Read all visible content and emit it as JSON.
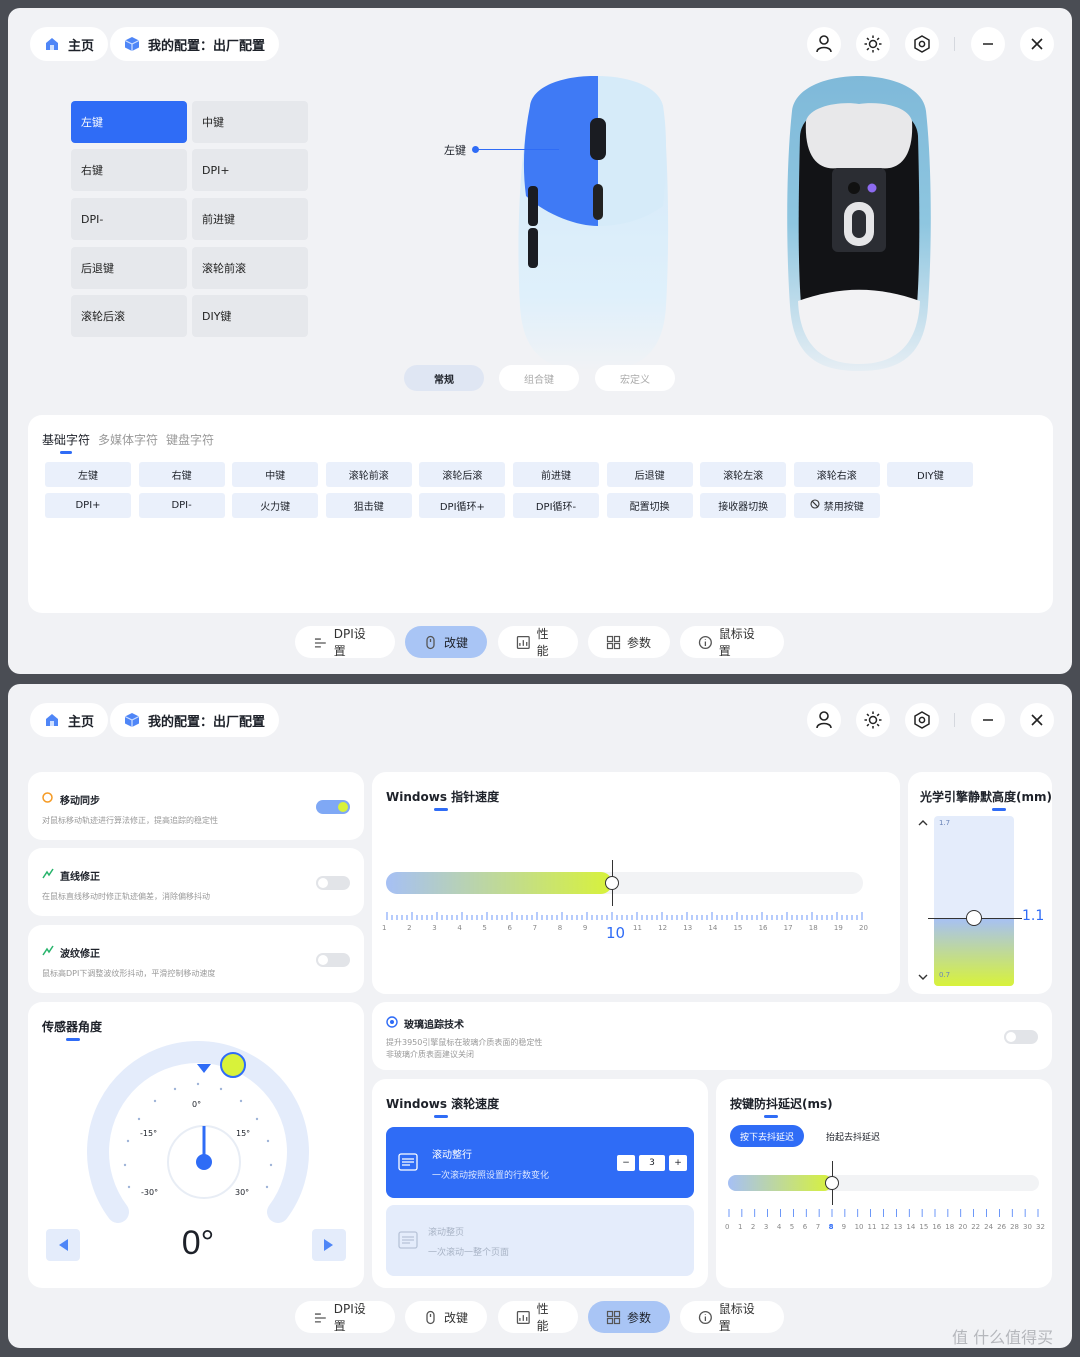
{
  "header": {
    "home": "主页",
    "config": "我的配置：出厂配置"
  },
  "icons": {
    "home": "home-icon",
    "config": "cube-icon",
    "user": "user-icon",
    "light": "light-icon",
    "settings": "hex-gear-icon",
    "minimize": "minimize-icon",
    "close": "close-icon"
  },
  "screen1": {
    "buttons": [
      "左键",
      "中键",
      "右键",
      "DPI+",
      "DPI-",
      "前进键",
      "后退键",
      "滚轮前滚",
      "滚轮后滚",
      "DIY键"
    ],
    "callout": "左键",
    "modes": [
      "常规",
      "组合键",
      "宏定义"
    ],
    "tabs": [
      "基础字符",
      "多媒体字符",
      "键盘字符"
    ],
    "keys_row1": [
      "左键",
      "右键",
      "中键",
      "滚轮前滚",
      "滚轮后滚",
      "前进键",
      "后退键",
      "滚轮左滚",
      "滚轮右滚",
      "DIY键"
    ],
    "keys_row2": [
      "DPI+",
      "DPI-",
      "火力键",
      "狙击键",
      "DPI循环+",
      "DPI循环-",
      "配置切换",
      "接收器切换",
      "禁用按键"
    ]
  },
  "nav": [
    "DPI设置",
    "改键",
    "性能",
    "参数",
    "鼠标设置"
  ],
  "screen2": {
    "toggles": [
      {
        "title": "移动同步",
        "desc": "对鼠标移动轨迹进行算法修正，提高追踪的稳定性",
        "on": true
      },
      {
        "title": "直线修正",
        "desc": "在鼠标直线移动时修正轨迹偏差，消除偏移抖动",
        "on": false
      },
      {
        "title": "波纹修正",
        "desc": "鼠标高DPI下调整波纹形抖动，平滑控制移动速度",
        "on": false
      }
    ],
    "pointer": {
      "title": "Windows 指针速度",
      "value": "10",
      "ticks": [
        "1",
        "2",
        "3",
        "4",
        "5",
        "6",
        "7",
        "8",
        "9",
        "10",
        "11",
        "12",
        "13",
        "14",
        "15",
        "16",
        "17",
        "18",
        "19",
        "20"
      ]
    },
    "lod": {
      "title": "光学引擎静默高度(mm)",
      "max": "1.7",
      "min": "0.7",
      "value": "1.1"
    },
    "sensor": {
      "title": "传感器角度",
      "value": "0°",
      "labels": [
        "0°",
        "-15°",
        "15°",
        "-30°",
        "30°"
      ]
    },
    "glass": {
      "title": "玻璃追踪技术",
      "desc1": "提升3950引擎鼠标在玻璃介质表面的稳定性",
      "desc2": "非玻璃介质表面建议关闭"
    },
    "scroll": {
      "title": "Windows 滚轮速度",
      "opt1_title": "滚动整行",
      "opt1_desc": "一次滚动按照设置的行数变化",
      "stepper_minus": "−",
      "stepper_value": "3",
      "stepper_plus": "+",
      "opt2_title": "滚动整页",
      "opt2_desc": "一次滚动一整个页面"
    },
    "debounce": {
      "title": "按键防抖延迟(ms)",
      "tab1": "按下去抖延迟",
      "tab2": "抬起去抖延迟",
      "ticks": [
        "0",
        "1",
        "2",
        "3",
        "4",
        "5",
        "6",
        "7",
        "8",
        "9",
        "10",
        "11",
        "12",
        "13",
        "14",
        "15",
        "16",
        "18",
        "20",
        "22",
        "24",
        "26",
        "28",
        "30",
        "32"
      ]
    }
  },
  "watermark": "值 什么值得买",
  "colors": {
    "accent": "#2f6cf6",
    "bg": "#f1f2f5",
    "lime": "#d8f23a"
  }
}
